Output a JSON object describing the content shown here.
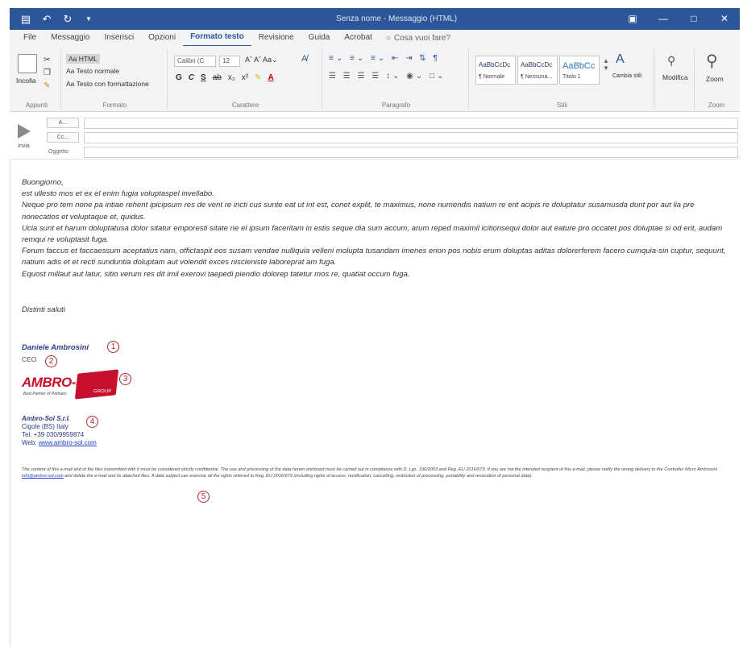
{
  "window": {
    "title": "Senza nome - Messaggio (HTML)"
  },
  "tabs": [
    {
      "label": "File"
    },
    {
      "label": "Messaggio"
    },
    {
      "label": "Inserisci"
    },
    {
      "label": "Opzioni"
    },
    {
      "label": "Formato testo"
    },
    {
      "label": "Revisione"
    },
    {
      "label": "Guida"
    },
    {
      "label": "Acrobat"
    }
  ],
  "tell_me": "Cosa vuoi fare?",
  "ribbon": {
    "appunti": {
      "label": "Appunti",
      "incolla": "Incolla"
    },
    "formato": {
      "label": "Formato",
      "html": "Aa HTML",
      "normale": "Aa Testo normale",
      "rtf": "Aa Testo con formattazione"
    },
    "carattere": {
      "label": "Carattere",
      "font": "Calibri (C",
      "size": "12",
      "bold": "G",
      "italic": "C",
      "underline": "S"
    },
    "paragrafo": {
      "label": "Paragrafo"
    },
    "stili": {
      "label": "Stili",
      "items": [
        {
          "sample": "AaBbCcDc",
          "name": "¶ Normale"
        },
        {
          "sample": "AaBbCcDc",
          "name": "¶ Nessuna..."
        },
        {
          "sample": "AaBbCc",
          "name": "Titolo 1"
        }
      ],
      "change": "Cambia stili"
    },
    "modifica": {
      "label": "Modifica"
    },
    "zoom": {
      "label": "Zoom",
      "btn": "Zoom"
    }
  },
  "header": {
    "send": "Invia",
    "to": "A...",
    "cc": "Cc...",
    "subject": "Oggetto"
  },
  "message": {
    "paragraphs": [
      "Buongiorno,",
      "est ullesto mos et ex el enim fugia voluptaspel invellabo.",
      "Neque pro tem none pa intiae rehent ipicipsum res de vent re incti cus sunte eat ut int est, conet explit, te maximus, none numendis natium re erit acipis re doluptatur susamusda dunt por aut lia pre nonecatios et voluptaque et, quidus.",
      "Ucia sunt et harum doluptatusa dolor sitatur emporesti sitate ne el ipsum faceritam in estis seque dia sum accum, arum reped maximil icitionsequi dolor aut eature pro occatet pos doluptae si od erit, audam remqui re voluptasit fuga.",
      "Ferum faccus et faccaessum aceptatius nam, offictaspit eos susam vendae nulliquia velleni molupta tusandam imenes erion pos nobis erum doluptas aditas dolorerferem facero cumquia-sin cuptur, sequunt, natium adis et et recti sunduntia doluptam aut volendit exces niscieniste laboreprat am fuga.",
      "Equost millaut aut latur, sitio verum res dit imil exerovi taepedi piendio dolorep tatetur mos re, quatiat occum fuga."
    ],
    "closing": "Distinti saluti"
  },
  "signature": {
    "name": "Daniele Ambrosini",
    "role": "CEO",
    "logo_main": "AMBRO-SOL",
    "logo_badge": "GROUP",
    "logo_tag": "Best Partner of Partners",
    "company_name": "Ambro-Sol S.r.l.",
    "address": "Cigole (BS) Italy",
    "phone": "Tel. +39 030/9959874",
    "web_label": "Web:",
    "web_url": "www.ambro-sol.com"
  },
  "disclaimer": {
    "text_before": "The content of this e-mail and of the files transmitted with it must be considered strictly confidential. The use and processing of the data herein enclosed must be carried out in compliance with D. Lgs. 196/2003 and Reg. EU 2016/679. If you are not the intended recipient of this e-mail, please notify the wrong delivery to the Controller Micro Ambrosini",
    "email": "info@ambro-sol.com",
    "text_after": "and delete the e-mail and its attached files. A data subject can exercise all the rights referred to Reg. EU 2016/679 (including rights of access, rectification, cancelling, restriction of processing, portability and revocation of personal data)."
  },
  "callouts": [
    "1",
    "2",
    "3",
    "4",
    "5"
  ],
  "colors": {
    "titlebar": "#2b579a",
    "callout": "#b3262d",
    "logo_red": "#c8102e",
    "link": "#1a44c4"
  }
}
